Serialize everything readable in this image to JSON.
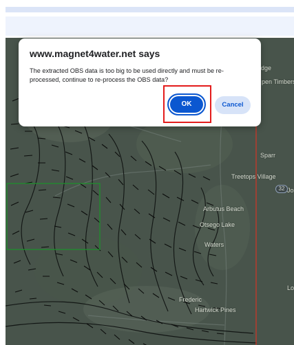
{
  "dialog": {
    "title": "www.magnet4water.net says",
    "message": "The extracted OBS data is too big to be used directly and must be re-processed, continue to re-process the OBS data?",
    "ok_label": "OK",
    "cancel_label": "Cancel"
  },
  "map": {
    "labels": {
      "edge": "edge",
      "pen_timbers": "pen Timbers",
      "sparr": "Sparr",
      "treetops_village": "Treetops Village",
      "arbutus_beach": "Arbutus Beach",
      "otsego_lake": "Otsego Lake",
      "waters": "Waters",
      "frederic": "Frederic",
      "hartwick_pines": "Hartwick Pines",
      "lo": "Lo",
      "jo": "Jo",
      "route_32": "32"
    }
  },
  "colors": {
    "highlight": "#e31b1b",
    "accent": "#0b57d0",
    "cancel_bg": "#d7e3f8",
    "domain_border": "#c0392b",
    "subdomain_border": "#1f8f2d"
  }
}
